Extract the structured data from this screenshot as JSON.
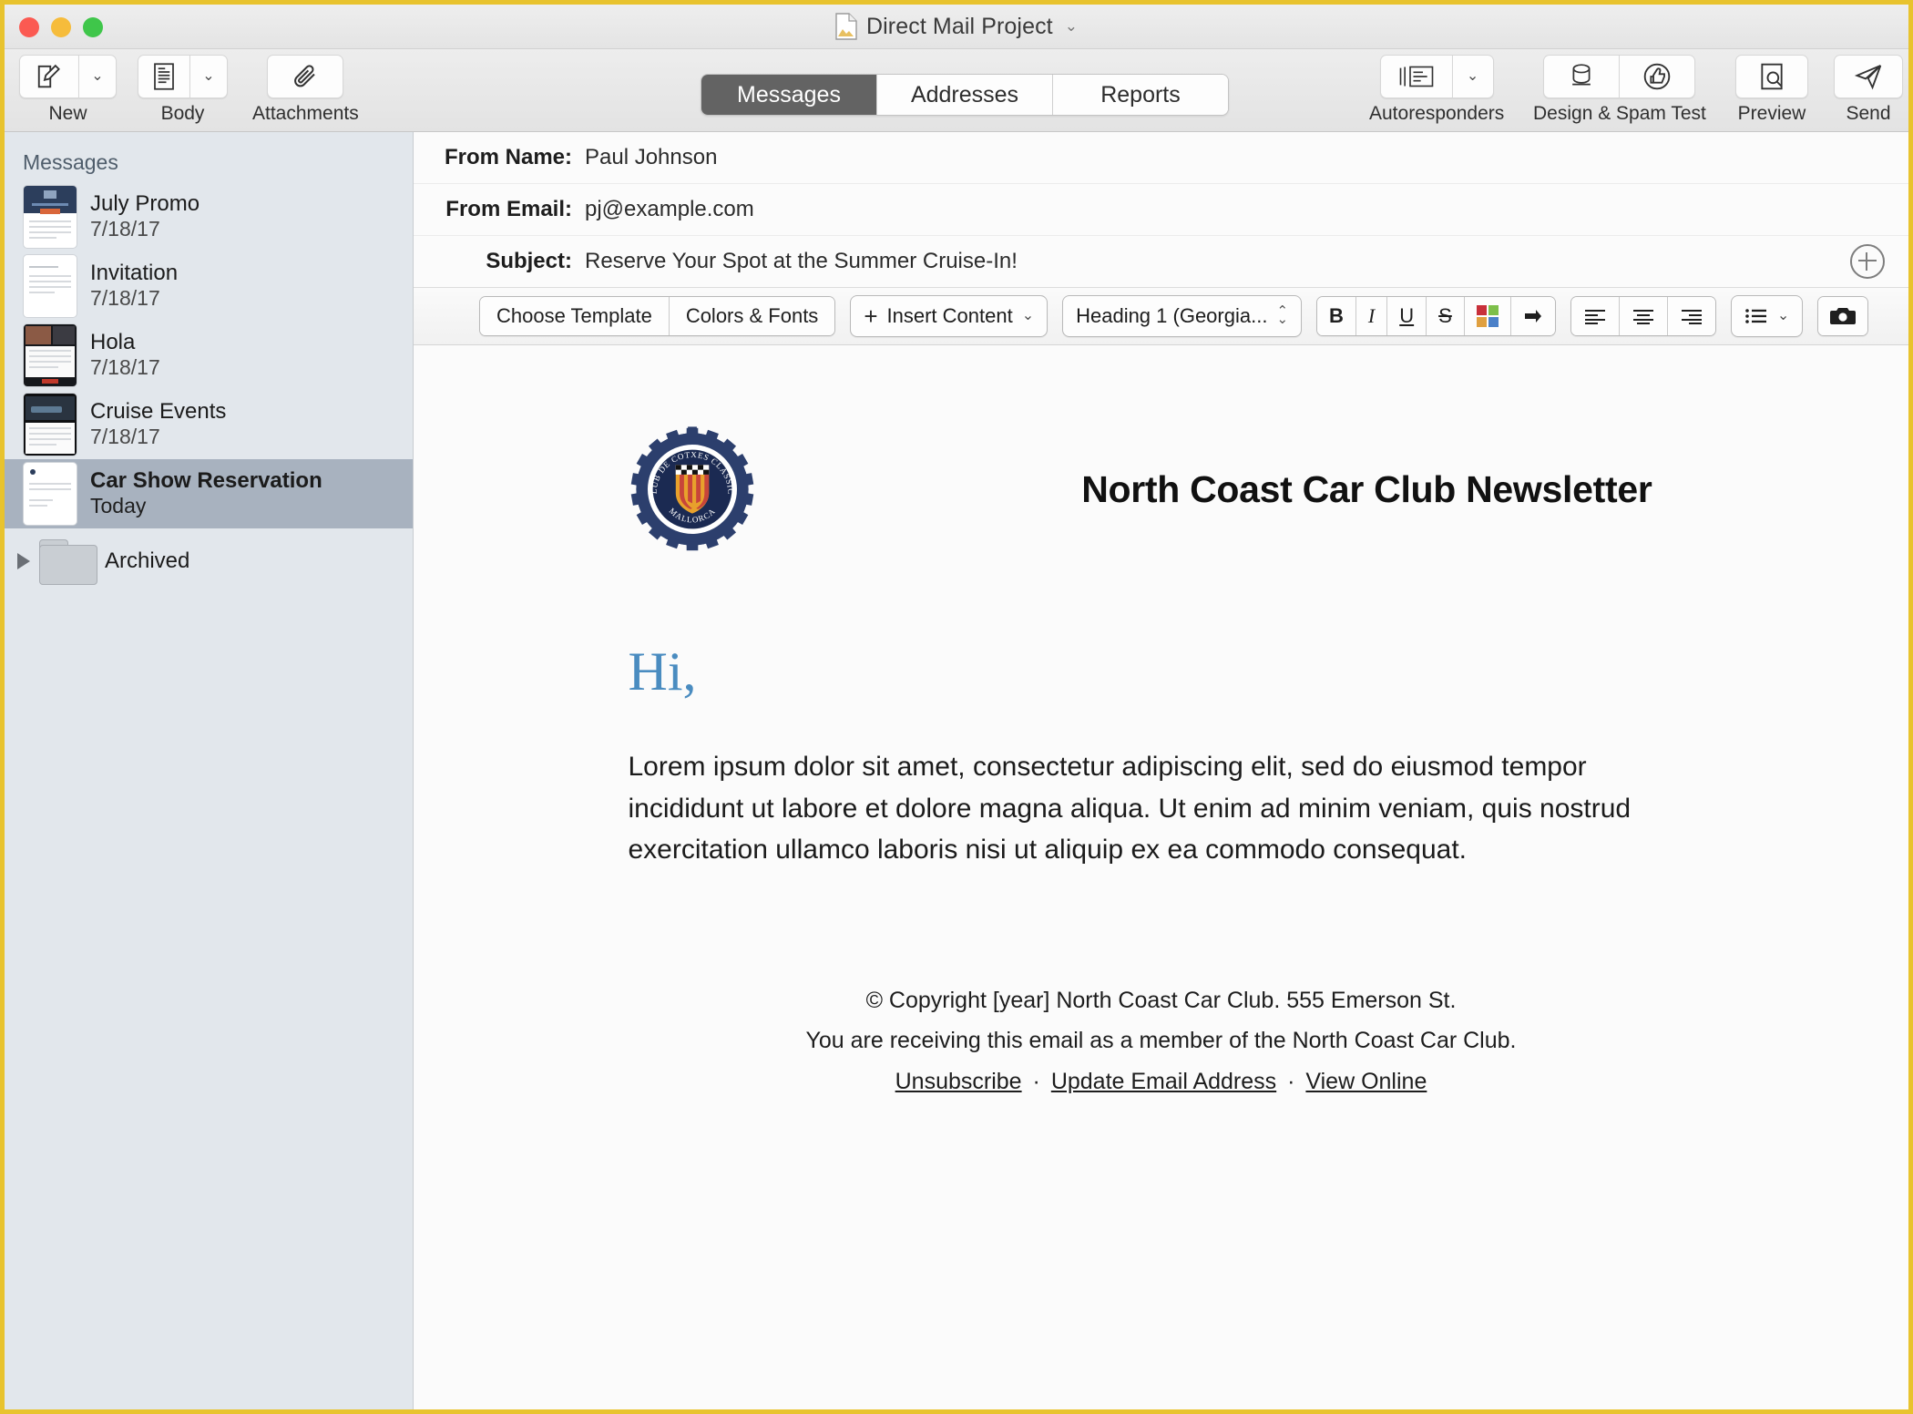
{
  "window": {
    "title": "Direct Mail Project",
    "title_icon": "document-icon",
    "title_chevron": "⌄",
    "traffic_lights": [
      "close",
      "minimize",
      "zoom"
    ],
    "accent_border": "#e8c32e"
  },
  "toolbar": {
    "items": [
      {
        "label": "New",
        "icon": "compose-icon",
        "has_dropdown": true
      },
      {
        "label": "Body",
        "icon": "body-template-icon",
        "has_dropdown": true
      },
      {
        "label": "Attachments",
        "icon": "paperclip-icon",
        "has_dropdown": false
      },
      {
        "label": "Autoresponders",
        "icon": "autoresponder-icon",
        "has_dropdown": true
      },
      {
        "label": "Design & Spam Test",
        "icon": "design-test-icon",
        "icon2": "thumbs-up-icon",
        "has_dropdown": false
      },
      {
        "label": "Preview",
        "icon": "preview-magnify-icon",
        "has_dropdown": false
      },
      {
        "label": "Send",
        "icon": "paper-plane-icon",
        "has_dropdown": false
      }
    ]
  },
  "tabs": {
    "items": [
      "Messages",
      "Addresses",
      "Reports"
    ],
    "active": "Messages",
    "active_bg": "#636363"
  },
  "sidebar": {
    "heading": "Messages",
    "messages": [
      {
        "title": "July Promo",
        "date": "7/18/17",
        "thumb": "dark-blue-header"
      },
      {
        "title": "Invitation",
        "date": "7/18/17",
        "thumb": "plain-white"
      },
      {
        "title": "Hola",
        "date": "7/18/17",
        "thumb": "photo-dark"
      },
      {
        "title": "Cruise Events",
        "date": "7/18/17",
        "thumb": "photo-night"
      },
      {
        "title": "Car Show Reservation",
        "date": "Today",
        "thumb": "plain-white",
        "selected": true
      }
    ],
    "archived": {
      "label": "Archived",
      "icon": "folder-icon",
      "disclosure": "collapsed"
    },
    "selected_bg": "#a8b2bf",
    "watermark": ""
  },
  "message_header": {
    "from_name": {
      "label": "From Name:",
      "value": "Paul Johnson"
    },
    "from_email": {
      "label": "From Email:",
      "value": "pj@example.com"
    },
    "subject": {
      "label": "Subject:",
      "value": "Reserve Your Spot at the Summer Cruise-In!"
    },
    "add_field_icon": "plus-circle-icon"
  },
  "format_bar": {
    "choose_template": "Choose Template",
    "colors_fonts": "Colors & Fonts",
    "insert_content": "Insert Content",
    "insert_plus": "+",
    "insert_chevron": "⌄",
    "style_select": "Heading 1 (Georgia...",
    "bold": "B",
    "italic": "I",
    "underline": "U",
    "strikethrough": "S",
    "text_color_icon": "color-swatch-icon",
    "indent_icon": "indent-arrow-icon",
    "align_left_icon": "align-left-icon",
    "align_center_icon": "align-center-icon",
    "align_right_icon": "align-right-icon",
    "list_icon": "bulleted-list-icon",
    "list_chevron": "⌄",
    "camera_icon": "camera-icon",
    "swatch_colors": [
      "#c8303a",
      "#7dbf4a",
      "#e0a040",
      "#4a80c8"
    ]
  },
  "email": {
    "logo": {
      "name": "club-de-cotxes-classics-mallorca-logo",
      "top_text": "CLUB DE COTXES CLASSICS",
      "bottom_text": "MALLORCA",
      "ring_color": "#2c3f6d",
      "field_color": "#1b2a52",
      "stripe_colors": [
        "#e8a12c",
        "#c8453a"
      ]
    },
    "newsletter_title": "North Coast Car Club Newsletter",
    "greeting": "Hi,",
    "greeting_color": "#4a8cc0",
    "body": "Lorem ipsum dolor sit amet, consectetur adipiscing elit, sed do eiusmod tempor incididunt ut labore et dolore magna aliqua. Ut enim ad minim veniam, quis nostrud exercitation ullamco laboris nisi ut aliquip ex ea commodo consequat.",
    "footer": {
      "copyright": "© Copyright [year] North Coast Car Club. 555 Emerson St.",
      "membership": "You are receiving this email as a member of the North Coast Car Club.",
      "links": [
        "Unsubscribe",
        "Update Email Address",
        "View Online"
      ],
      "separator": "·"
    }
  }
}
